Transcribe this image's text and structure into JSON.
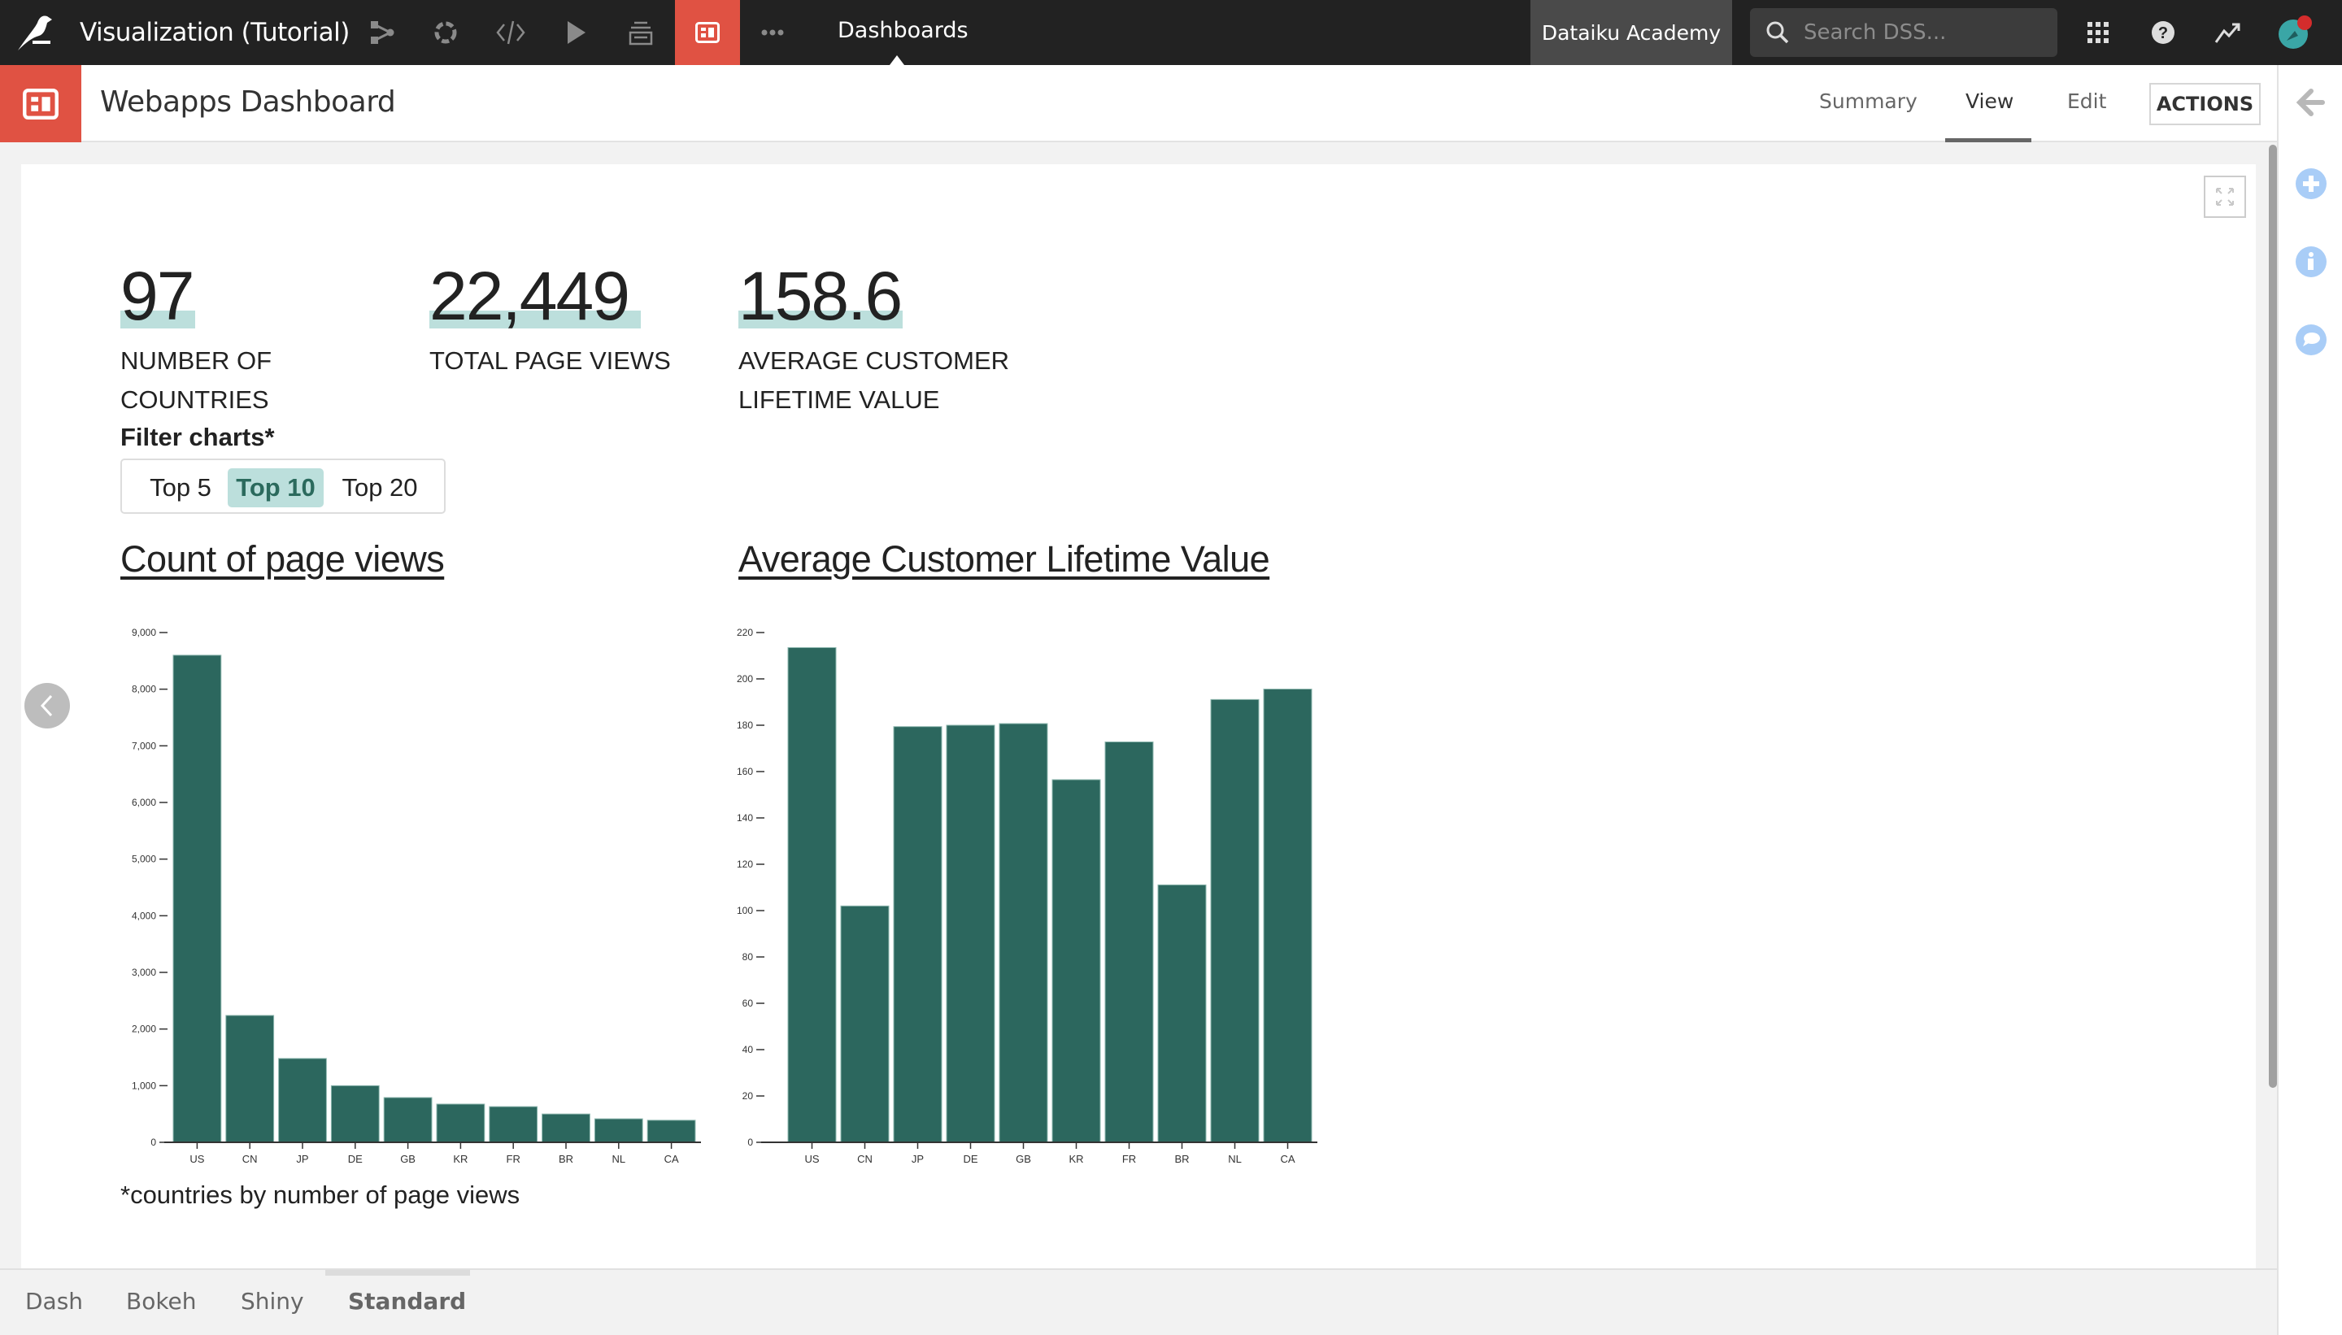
{
  "topbar": {
    "project_title": "Visualization (Tutorial)",
    "nav_icons": [
      "flow-icon",
      "recipes-icon",
      "code-icon",
      "run-icon",
      "datasets-icon",
      "dashboard-icon",
      "more-icon"
    ],
    "current_section": "Dashboards",
    "academy_label": "Dataiku Academy",
    "search_placeholder": "Search DSS...",
    "right_icons": [
      "apps-grid-icon",
      "help-icon",
      "activity-icon",
      "user-avatar"
    ],
    "accent_color": "#e05243"
  },
  "header": {
    "title": "Webapps Dashboard",
    "tabs": [
      {
        "label": "Summary",
        "active": false
      },
      {
        "label": "View",
        "active": true
      },
      {
        "label": "Edit",
        "active": false
      }
    ],
    "actions_label": "ACTIONS"
  },
  "right_sidebar": {
    "icons": [
      "collapse-arrow-icon",
      "add-icon",
      "info-icon",
      "comment-icon"
    ]
  },
  "metrics": [
    {
      "value": "97",
      "label_line1": "NUMBER OF",
      "label_line2": "COUNTRIES"
    },
    {
      "value": "22,449",
      "label_line1": "TOTAL PAGE VIEWS",
      "label_line2": ""
    },
    {
      "value": "158.6",
      "label_line1": "AVERAGE CUSTOMER",
      "label_line2": "LIFETIME VALUE"
    }
  ],
  "filter": {
    "label": "Filter charts*",
    "options": [
      {
        "label": "Top 5",
        "active": false
      },
      {
        "label": "Top 10",
        "active": true
      },
      {
        "label": "Top 20",
        "active": false
      }
    ]
  },
  "footnote": "*countries by number of page views",
  "bottom_tabs": [
    {
      "label": "Dash",
      "active": false
    },
    {
      "label": "Bokeh",
      "active": false
    },
    {
      "label": "Shiny",
      "active": false
    },
    {
      "label": "Standard",
      "active": true
    }
  ],
  "chart_data": [
    {
      "type": "bar",
      "title": "Count of page views",
      "categories": [
        "US",
        "CN",
        "JP",
        "DE",
        "GB",
        "KR",
        "FR",
        "BR",
        "NL",
        "CA"
      ],
      "values": [
        8600,
        2240,
        1480,
        1000,
        790,
        675,
        630,
        500,
        415,
        390
      ],
      "yticks": [
        0,
        1000,
        2000,
        3000,
        4000,
        5000,
        6000,
        7000,
        8000,
        9000
      ],
      "ytick_labels": [
        "0",
        "1,000",
        "2,000",
        "3,000",
        "4,000",
        "5,000",
        "6,000",
        "7,000",
        "8,000",
        "9,000"
      ],
      "ylim": [
        0,
        9000
      ],
      "xlabel": "",
      "ylabel": "",
      "bar_color": "#2c675e",
      "grid": false
    },
    {
      "type": "bar",
      "title": "Average Customer Lifetime Value",
      "categories": [
        "US",
        "CN",
        "JP",
        "DE",
        "GB",
        "KR",
        "FR",
        "BR",
        "NL",
        "CA"
      ],
      "values": [
        213.5,
        102,
        179.4,
        180,
        180.7,
        156.5,
        172.8,
        111.1,
        191.1,
        195.6
      ],
      "yticks": [
        0,
        20,
        40,
        60,
        80,
        100,
        120,
        140,
        160,
        180,
        200,
        220
      ],
      "ytick_labels": [
        "0",
        "20",
        "40",
        "60",
        "80",
        "100",
        "120",
        "140",
        "160",
        "180",
        "200",
        "220"
      ],
      "ylim": [
        0,
        220
      ],
      "xlabel": "",
      "ylabel": "",
      "bar_color": "#2c675e",
      "grid": false
    }
  ]
}
